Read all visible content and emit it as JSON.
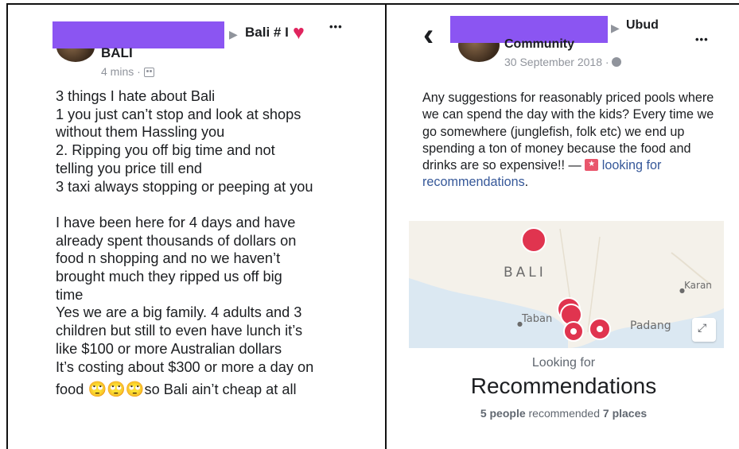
{
  "left_post": {
    "group_name": "Bali # I",
    "group_sub": "BALI",
    "heart_glyph": "♥",
    "more_glyph": "•••",
    "time": "4 mins",
    "lines": [
      "3 things I hate about Bali",
      "1 you just can’t stop and look at shops",
      "without them Hassling you",
      "2. Ripping you off big time and not",
      "telling you price till end",
      "3 taxi always stopping or peeping at you",
      "",
      "I have been here for 4 days and have",
      "already spent thousands of dollars on",
      "food n shopping and no we haven’t",
      "brought much they ripped us off big",
      "time",
      "Yes we are a big family. 4 adults and 3",
      "children but still to even have lunch it’s",
      "like $100 or more Australian dollars",
      "It’s costing about $300 or more a day on"
    ],
    "last_line_start": "food",
    "emoji_glyphs": [
      "🙄",
      "🙄",
      "🙄"
    ],
    "last_line_end": "so Bali ain’t cheap at all"
  },
  "right_post": {
    "back_glyph": "‹",
    "group_name": "Ubud",
    "group_sub": "Community",
    "more_glyph": "•••",
    "date": "30 September 2018",
    "text_before_tag": "Any suggestions for reasonably priced pools where we can spend the day with the kids? Every time we go somewhere (junglefish, folk etc) we end up spending a ton of money because the food and drinks are so expensive!! —",
    "tag_text": "looking for recommendations",
    "text_after_tag": ".",
    "map": {
      "region_label": "BALI",
      "places": [
        "Karan",
        "Taban",
        "Padang"
      ]
    },
    "looking_for_label": "Looking for",
    "recommendations_title": "Recommendations",
    "people_count": "5 people",
    "recommended_text": "recommended",
    "places_count": "7 places"
  }
}
